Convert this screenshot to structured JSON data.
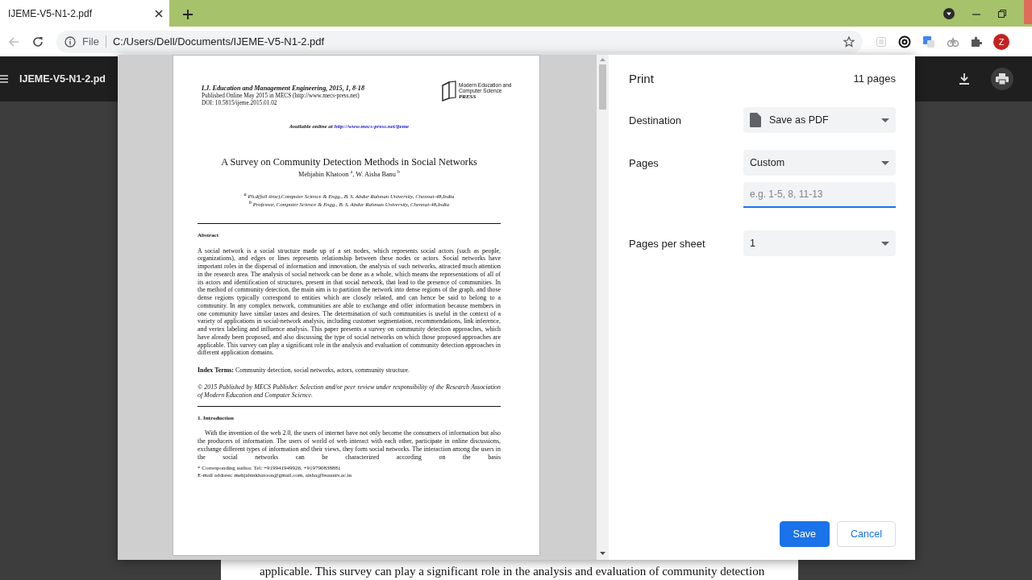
{
  "browser": {
    "tabs": [
      {
        "title": "IJEME-V5-N1-2.pdf",
        "selected": true
      }
    ],
    "back_disabled": true,
    "address": {
      "scheme_label": "File",
      "url": "C:/Users/Dell/Documents/IJEME-V5-N1-2.pdf"
    },
    "profile_initial": "Z"
  },
  "viewer": {
    "title": "IJEME-V5-N1-2.pd",
    "behind_page_text": "applicable. This survey can play a significant role in the analysis and evaluation of community detection"
  },
  "print_dialog": {
    "title": "Print",
    "page_count": "11 pages",
    "settings": [
      {
        "kind": "destination",
        "label": "Destination",
        "value": "Save as PDF"
      },
      {
        "kind": "select",
        "label": "Pages",
        "value": "Custom"
      },
      {
        "kind": "field",
        "placeholder": "e.g. 1-5, 8, 11-13",
        "focused": true
      },
      {
        "kind": "select",
        "label": "Pages per sheet",
        "value": "1"
      }
    ],
    "buttons": [
      {
        "label": "Save",
        "primary": true
      },
      {
        "label": "Cancel",
        "primary": false
      }
    ],
    "preview": {
      "journal": "I.J. Education and Management Engineering, 2015, 1, 8-18",
      "published": "Published Online May 2015 in MECS (http://www.mecs-press.net)",
      "doi": "DOI: 10.5815/ijeme.2015.01.02",
      "logo_lines": [
        "Modern Education and Computer Science",
        "PRESS"
      ],
      "available_label": "Available online at",
      "available_link": "http://www.mecs-press.net/ijeme",
      "title": "A Survey on Community Detection Methods in Social Networks",
      "authors": "Mehjabin Khatoon $^{a}$, W. Aisha Banu $^{b}$",
      "affiliations": [
        "$^{a}$ Ph.d(full time),Computer Science & Engg., B. S. Abdur Rahman University, Chennai-48,India",
        "$^{b}$ Professor, Computer Science & Engg., B. S. Abdur Rahman University, Chennai-48,India"
      ],
      "abstract_heading": "Abstract",
      "abstract": "A social network is a social structure made up of a set nodes, which represents social actors (such as people, organizations), and edges or lines represents relationship between these nodes or actors. Social networks have important roles in the dispersal of information and innovation, the analysis of such networks, attracted much attention in the research area. The analysis of social network can be done as a whole, which means the representations of all of its actors and identification of structures, present in that social network, that lead to the presence of communities. In the method of community detection, the main aim is to partition the network into dense regions of the graph, and those dense regions typically correspond to entities which are closely related, and can hence be said to belong to a community. In any complex network, communities are able to exchange and offer information because members in one community have similar tastes and desires. The determination of such communities is useful in the context of a variety of applications in social-network analysis, including customer segmentation, recommendations, link inference, and vertex labeling and influence analysis. This paper presents a survey on community detection approaches, which have already been proposed, and also discussing the type of social networks on which those proposed approaches are applicable. This survey can play a significant role in the analysis and evaluation of community detection approaches in different application domains.",
      "index_terms": "**Index Terms:** Community detection, social networks, actors, community structure.",
      "copyright": "© 2015 Published by MECS Publisher. Selection and/or peer review under responsibility of the Research Association of Modern Education and Computer Science.",
      "section_heading": "1. Introduction",
      "intro": "With the invention of the web 2.0, the users of internet have not only become the consumers of information but also the producers of information. The users of world of web interact with each other, participate in online discussions, exchange different types of information and their views, they form social networks. The interaction among the users in the social networks can be characterized according on the basis",
      "footnotes": [
        "* Corresponding author. Tel: +919941949926, +919790838881",
        "E-mail address: mehjabinkhatoon@gmail.com, aisha@bsauniv.ac.in"
      ]
    }
  }
}
